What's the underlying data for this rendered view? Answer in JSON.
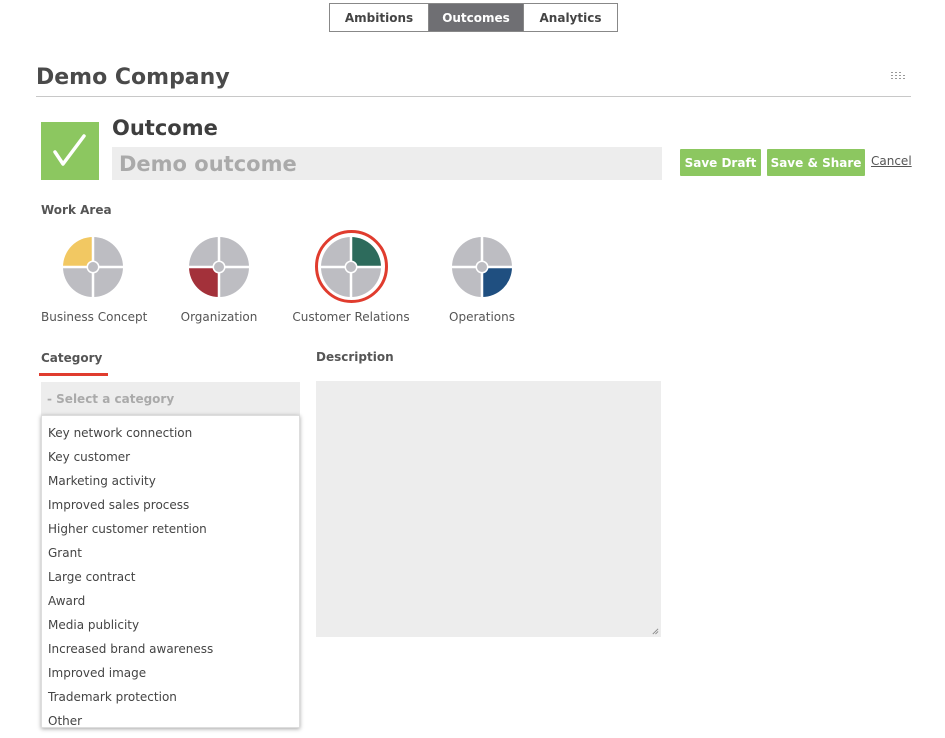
{
  "nav": {
    "tabs": [
      {
        "label": "Ambitions",
        "active": false
      },
      {
        "label": "Outcomes",
        "active": true
      },
      {
        "label": "Analytics",
        "active": false
      }
    ]
  },
  "company": {
    "name": "Demo Company"
  },
  "outcome": {
    "heading": "Outcome",
    "title_value": "Demo outcome",
    "icon": "checkmark-icon"
  },
  "actions": {
    "save_draft": "Save Draft",
    "save_share": "Save & Share",
    "cancel": "Cancel"
  },
  "work_area": {
    "label": "Work Area",
    "items": [
      {
        "name": "Business Concept",
        "color": "#f2c862",
        "quadrant": "top-left",
        "selected": false
      },
      {
        "name": "Organization",
        "color": "#a3313a",
        "quadrant": "bottom-left",
        "selected": false
      },
      {
        "name": "Customer Relations",
        "color": "#2d6b5c",
        "quadrant": "top-right",
        "selected": true
      },
      {
        "name": "Operations",
        "color": "#1f4f80",
        "quadrant": "bottom-right",
        "selected": false
      }
    ]
  },
  "category": {
    "label": "Category",
    "placeholder": "- Select a category",
    "options": [
      "Key network connection",
      "Key customer",
      "Marketing activity",
      "Improved sales process",
      "Higher customer retention",
      "Grant",
      "Large contract",
      "Award",
      "Media publicity",
      "Increased brand awareness",
      "Improved image",
      "Trademark protection",
      "Other"
    ]
  },
  "description": {
    "label": "Description",
    "value": ""
  },
  "colors": {
    "accent_green": "#8cc760",
    "selection_red": "#e03c2e",
    "quadrant_gray": "#bdbdc2"
  }
}
